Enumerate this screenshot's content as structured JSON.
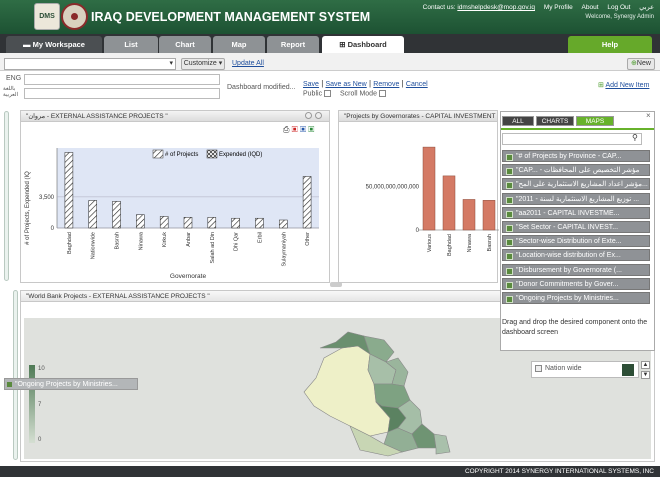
{
  "header": {
    "app_title": "IRAQ DEVELOPMENT MANAGEMENT SYSTEM",
    "logo_text": "DMS",
    "contact_label": "Contact us:",
    "contact_email": "idmshelpdesk@mop.gov.iq",
    "links": [
      "My Profile",
      "About",
      "Log Out",
      "عربي"
    ],
    "welcome": "Welcome, Synergy Admin"
  },
  "tabs": {
    "workspace": "My Workspace",
    "list": "List",
    "chart": "Chart",
    "map": "Map",
    "report": "Report",
    "dashboard": "Dashboard",
    "help": "Help"
  },
  "toolbar": {
    "customize": "Customize",
    "update_all": "Update All",
    "new": "New",
    "lang_eng": "ENG",
    "lang_ar": "باللغة العربية",
    "modified": "Dashboard modified...",
    "save": "Save",
    "save_as_new": "Save as New",
    "remove": "Remove",
    "cancel": "Cancel",
    "public": "Public",
    "scroll_mode": "Scroll Mode",
    "add_new_item": "Add New Item"
  },
  "panel1": {
    "title": "\"مروان - EXTERNAL ASSISTANCE PROJECTS \"",
    "legend": [
      "# of Projects",
      "Expended (IQD)"
    ],
    "ylabel": "# of Projects, Expended (IQ",
    "xlabel": "Governorate"
  },
  "panel2": {
    "title": "\"Projects by Governorates - CAPITAL INVESTMENT"
  },
  "panel3": {
    "title": "\"World Bank Projects - EXTERNAL ASSISTANCE PROJECTS \""
  },
  "chart_data": [
    {
      "type": "bar",
      "categories": [
        "Baghdad",
        "Nationwide",
        "Basrah",
        "Ninawa",
        "Kirkuk",
        "Anbar",
        "Salah ad Din",
        "Dhi Qar",
        "Erbil",
        "Sulaymaniyah",
        "Other"
      ],
      "series": [
        {
          "name": "# of Projects",
          "values": [
            8500,
            3100,
            3000,
            1500,
            1300,
            1200,
            1200,
            1100,
            1100,
            900,
            5800
          ]
        },
        {
          "name": "Expended (IQD)",
          "values": [
            0,
            0,
            0,
            0,
            0,
            0,
            0,
            0,
            0,
            0,
            0
          ]
        }
      ],
      "yticks": [
        "0",
        "3,500"
      ],
      "ylim": [
        0,
        9000
      ],
      "xlabel": "Governorate",
      "ylabel": "# of Projects, Expended (IQ"
    },
    {
      "type": "bar",
      "categories": [
        "Various",
        "Baghdad",
        "Ninawa",
        "Basrah"
      ],
      "values": [
        95000000000000,
        62000000000000,
        35000000000000,
        34000000000000
      ],
      "yticks": [
        "0",
        "50,000,000,000,000"
      ],
      "ylim": [
        0,
        110000000000000
      ]
    }
  ],
  "side": {
    "tabs": [
      "ALL",
      "CHARTS",
      "MAPS"
    ],
    "items": [
      "\"# of Projects by Province - CAP...",
      "\"CAP... - مؤشر التخصيص على المحافظات",
      "\"مؤشر اعداد المشاريع الاستثمارية على المح...",
      "\"2011 - توزيع المشاريع الاستثمارية لسنة ...",
      "\"aa2011 - CAPITAL INVESTME...",
      "\"Set Sector - CAPITAL INVEST...",
      "\"Sector-wise Distribution of Exte...",
      "\"Location-wise distribution of Ex...",
      "\"Disbursement by Governorate (...",
      "\"Donor Commitments by Gover...",
      "\"Ongoing Projects by Ministries..."
    ],
    "hint": "Drag and drop the desired component onto the dashboard screen"
  },
  "map": {
    "legend_max": "10",
    "legend_mid": "7",
    "legend_min": "0",
    "nation_wide": "Nation wide",
    "drag_item": "\"Ongoing Projects by Ministries..."
  },
  "footer": "COPYRIGHT 2014 SYNERGY INTERNATIONAL SYSTEMS, INC",
  "colors": {
    "header_green": "#2f6d45",
    "accent_green": "#66a92a",
    "bar_salmon": "#d47a65",
    "map_fill": "#7fa383"
  }
}
